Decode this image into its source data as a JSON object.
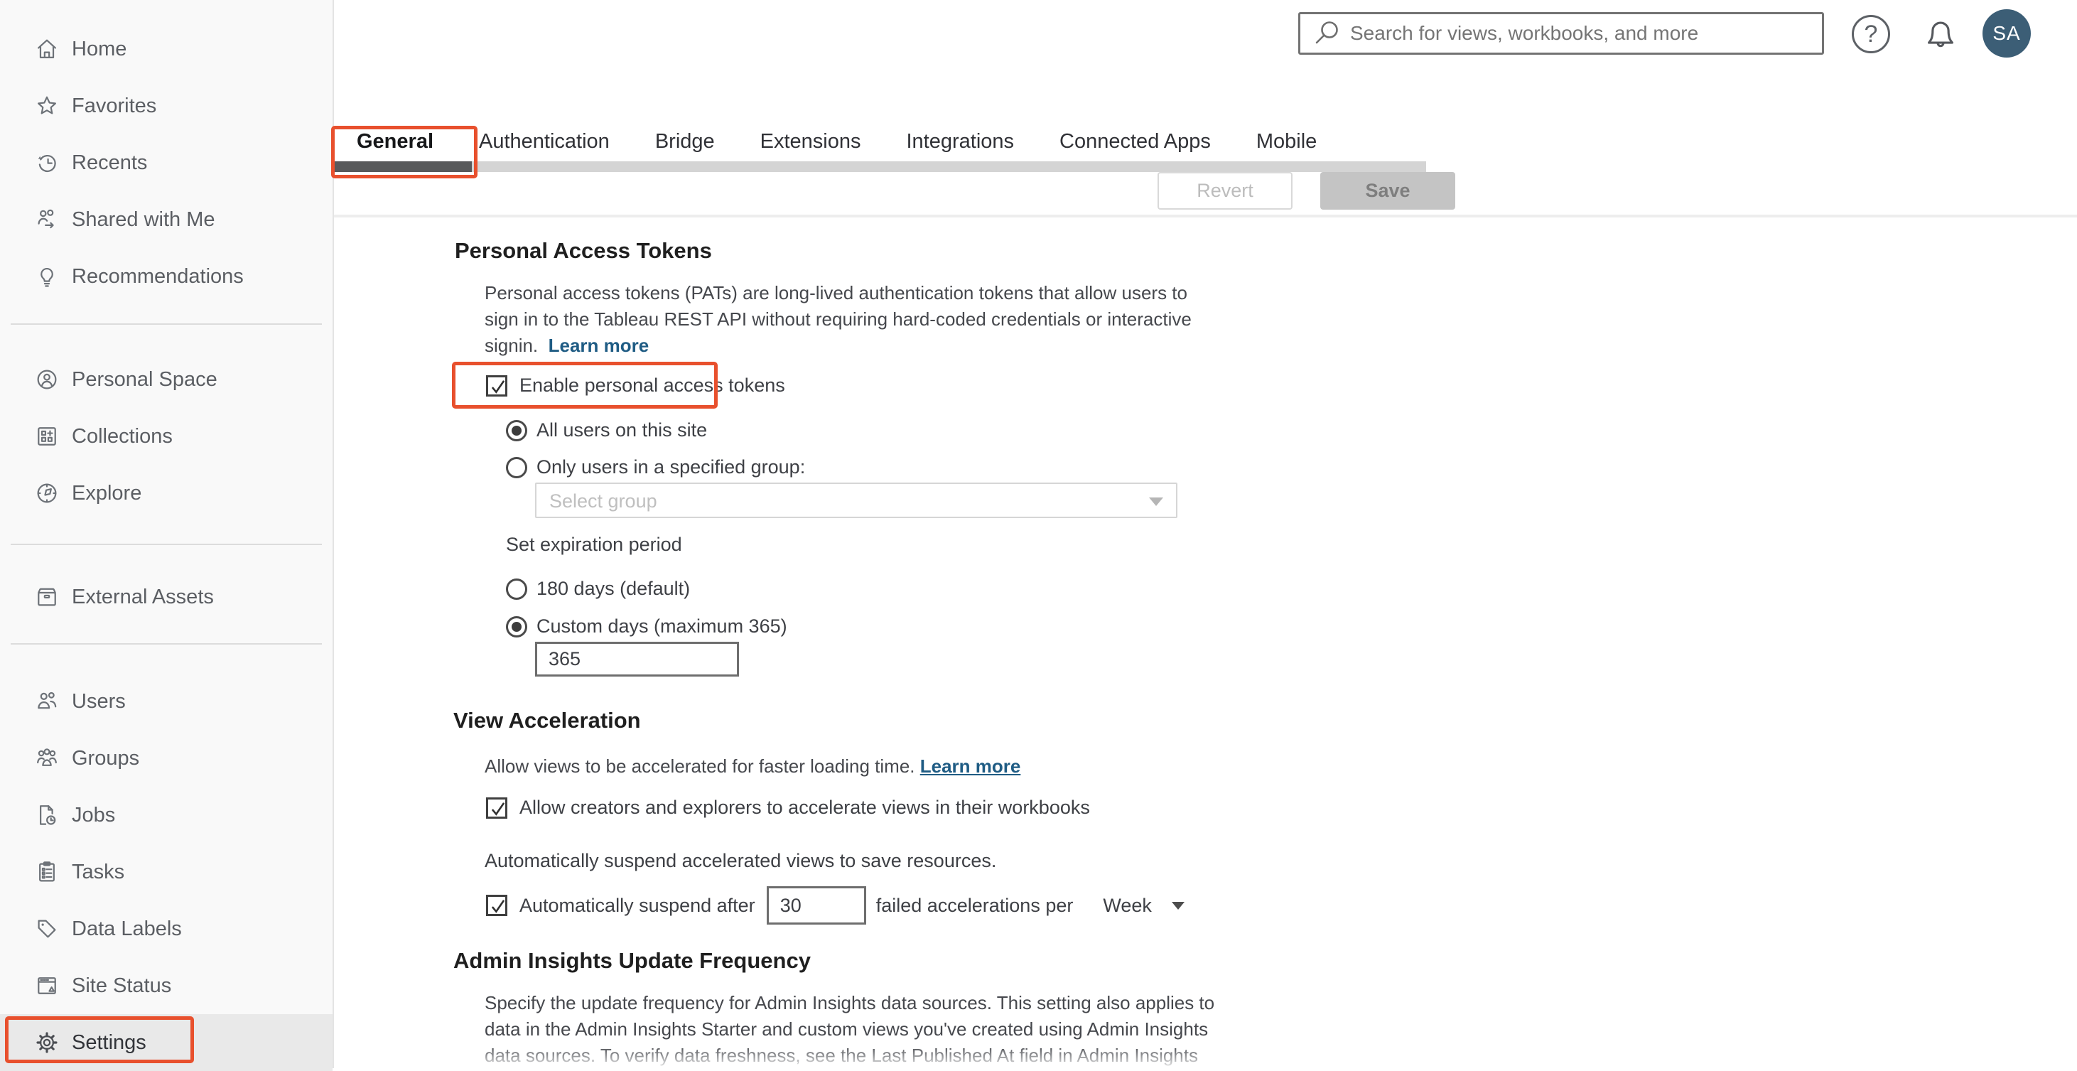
{
  "colors": {
    "annotation": "#e8502d",
    "link_blue": "#1f5c84",
    "avatar_bg": "#3c5e76",
    "active_tab_indicator": "#58595b",
    "sidebar_selected_bg": "#e9e9e9"
  },
  "header": {
    "search_placeholder": "Search for views, workbooks, and more",
    "help_glyph": "?",
    "avatar_initials": "SA"
  },
  "sidebar": {
    "items": [
      {
        "label": "Home",
        "icon": "home-icon"
      },
      {
        "label": "Favorites",
        "icon": "star-icon"
      },
      {
        "label": "Recents",
        "icon": "clock-history-icon"
      },
      {
        "label": "Shared with Me",
        "icon": "shared-with-me-icon"
      },
      {
        "label": "Recommendations",
        "icon": "lightbulb-icon"
      },
      {
        "label": "Personal Space",
        "icon": "person-circle-icon"
      },
      {
        "label": "Collections",
        "icon": "collections-grid-icon"
      },
      {
        "label": "Explore",
        "icon": "compass-icon"
      },
      {
        "label": "External Assets",
        "icon": "archive-box-icon"
      },
      {
        "label": "Users",
        "icon": "users-icon"
      },
      {
        "label": "Groups",
        "icon": "groups-icon"
      },
      {
        "label": "Jobs",
        "icon": "page-clock-icon"
      },
      {
        "label": "Tasks",
        "icon": "clipboard-list-icon"
      },
      {
        "label": "Data Labels",
        "icon": "tag-icon"
      },
      {
        "label": "Site Status",
        "icon": "site-status-icon"
      },
      {
        "label": "Settings",
        "icon": "gear-icon",
        "selected": true
      }
    ]
  },
  "tabs": {
    "items": [
      {
        "label": "General",
        "active": true
      },
      {
        "label": "Authentication",
        "active": false
      },
      {
        "label": "Bridge",
        "active": false
      },
      {
        "label": "Extensions",
        "active": false
      },
      {
        "label": "Integrations",
        "active": false
      },
      {
        "label": "Connected Apps",
        "active": false
      },
      {
        "label": "Mobile",
        "active": false
      }
    ],
    "revert_label": "Revert",
    "save_label": "Save"
  },
  "sections": {
    "personal_access_tokens": {
      "title": "Personal Access Tokens",
      "desc_lines": [
        "Personal access tokens (PATs) are long-lived authentication tokens that allow users to",
        "sign in to the Tableau REST API without requiring hard-coded credentials or interactive",
        "signin."
      ],
      "learn_more": "Learn more",
      "enable_checkbox": {
        "label": "Enable personal access tokens",
        "checked": true
      },
      "scope_options": [
        {
          "label": "All users on this site",
          "selected": true
        },
        {
          "label": "Only users in a specified group:",
          "selected": false
        }
      ],
      "group_select_placeholder": "Select group",
      "expiration_label": "Set expiration period",
      "expiration_options": [
        {
          "label": "180 days (default)",
          "selected": false
        },
        {
          "label": "Custom days (maximum 365)",
          "selected": true
        }
      ],
      "custom_days_value": "365"
    },
    "view_acceleration": {
      "title": "View Acceleration",
      "description": "Allow views to be accelerated for faster loading time.",
      "learn_more": "Learn more",
      "allow_checkbox": {
        "label": "Allow creators and explorers to accelerate views in their workbooks",
        "checked": true
      },
      "suspend_note": "Automatically suspend accelerated views to save resources.",
      "suspend_checkbox": {
        "label": "Automatically suspend after",
        "checked": true
      },
      "suspend_threshold_value": "30",
      "suspend_suffix": "failed accelerations per",
      "suspend_period": "Week"
    },
    "admin_insights": {
      "title": "Admin Insights Update Frequency",
      "desc_lines": [
        "Specify the update frequency for Admin Insights data sources. This setting also applies to",
        "data in the Admin Insights Starter and custom views you've created using Admin Insights",
        "data sources. To verify data freshness, see the Last Published At field in Admin Insights"
      ]
    }
  }
}
